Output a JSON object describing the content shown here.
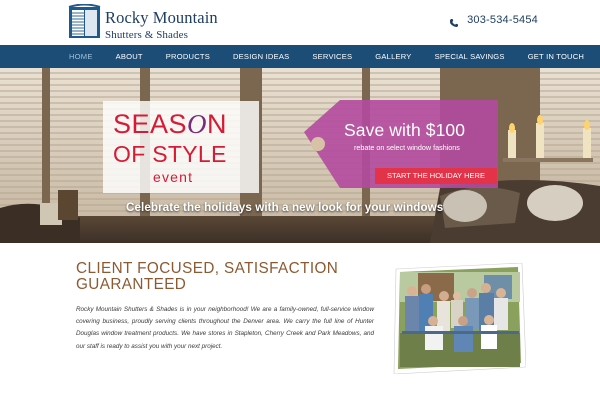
{
  "header": {
    "brand_line1": "Rocky Mountain",
    "brand_line2": "Shutters & Shades",
    "phone": "303-534-5454",
    "phone_icon": "phone-icon",
    "logo_icon": "window-shutter-icon"
  },
  "nav": {
    "items": [
      {
        "label": "HOME",
        "active": true
      },
      {
        "label": "ABOUT",
        "active": false
      },
      {
        "label": "PRODUCTS",
        "active": false
      },
      {
        "label": "DESIGN IDEAS",
        "active": false
      },
      {
        "label": "SERVICES",
        "active": false
      },
      {
        "label": "GALLERY",
        "active": false
      },
      {
        "label": "SPECIAL SAVINGS",
        "active": false
      },
      {
        "label": "GET IN TOUCH",
        "active": false
      }
    ]
  },
  "hero": {
    "season_word1": "SEAS",
    "season_o": "O",
    "season_word2": "N",
    "season_line2": "OF STYLE",
    "season_line3": "event",
    "tag_title": "Save with $100",
    "tag_subtitle": "rebate on select window fashions",
    "cta_label": "START THE HOLIDAY HERE",
    "caption": "Celebrate the holidays with a new look for your windows"
  },
  "content": {
    "title": "CLIENT FOCUSED, SATISFACTION GUARANTEED",
    "body": "Rocky Mountain Shutters & Shades is in your neighborhood! We are a family-owned, full-service window covering business, proudly serving clients throughout the Denver area. We carry the full line of Hunter Douglas window treatment products. We have stores in Stapleton, Cherry Creek and Park Meadows, and our staff is ready to assist you with your next project."
  },
  "colors": {
    "navy": "#1b4d77",
    "brand_text": "#1f3e63",
    "accent_red": "#e23349",
    "tag_purple": "#b44a9e",
    "title_brown": "#8c5a32"
  }
}
